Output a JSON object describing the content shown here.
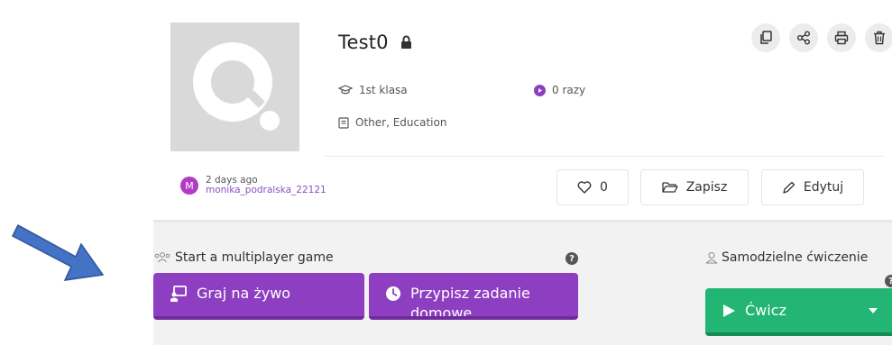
{
  "quiz": {
    "title": "Test0",
    "grade": "1st klasa",
    "plays": "0 razy",
    "subjects": "Other, Education"
  },
  "author": {
    "avatar_letter": "M",
    "time": "2 days ago",
    "username": "monika_podralska_22121"
  },
  "actions": {
    "likes": "0",
    "save_label": "Zapisz",
    "edit_label": "Edytuj"
  },
  "multiplayer": {
    "section_label": "Start a multiplayer game",
    "live_label": "Graj na żywo",
    "homework_label": "Przypisz zadanie domowe"
  },
  "solo": {
    "section_label": "Samodzielne ćwiczenie",
    "practice_label": "Ćwicz"
  },
  "colors": {
    "brand_purple": "#8e3fc1",
    "practice_green": "#22b573",
    "annotation_arrow": "#4472c4"
  },
  "icons": [
    "copy-icon",
    "share-icon",
    "print-icon",
    "delete-icon",
    "lock-icon",
    "graduation-cap-icon",
    "play-icon",
    "book-icon",
    "heart-icon",
    "folder-icon",
    "pencil-icon",
    "users-icon",
    "user-icon",
    "help-icon",
    "presentation-icon",
    "clock-icon",
    "caret-down-icon"
  ]
}
